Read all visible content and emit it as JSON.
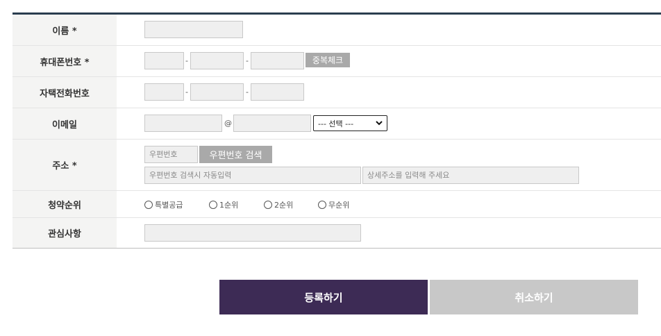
{
  "form": {
    "name": {
      "label": "이름 *"
    },
    "phone": {
      "label": "휴대폰번호 *",
      "sep1": "-",
      "sep2": "-",
      "check_button": "중복체크"
    },
    "home_phone": {
      "label": "자택전화번호",
      "sep1": "-",
      "sep2": "-"
    },
    "email": {
      "label": "이메일",
      "at": "@",
      "domain_select": "--- 선택 ---"
    },
    "address": {
      "label": "주소 *",
      "zip_placeholder": "우편번호",
      "zip_button": "우편번호 검색",
      "auto_placeholder": "우편번호 검색시 자동입력",
      "detail_placeholder": "상세주소를 입력해 주세요"
    },
    "priority": {
      "label": "청약순위",
      "options": [
        "특별공급",
        "1순위",
        "2순위",
        "무순위"
      ]
    },
    "interest": {
      "label": "관심사항"
    }
  },
  "actions": {
    "submit": "등록하기",
    "cancel": "취소하기"
  },
  "colors": {
    "submit_bg": "#3d2b55",
    "cancel_bg": "#c8c8c8",
    "header_border": "#2a3d4f",
    "label_bg": "#f4f4f3"
  }
}
